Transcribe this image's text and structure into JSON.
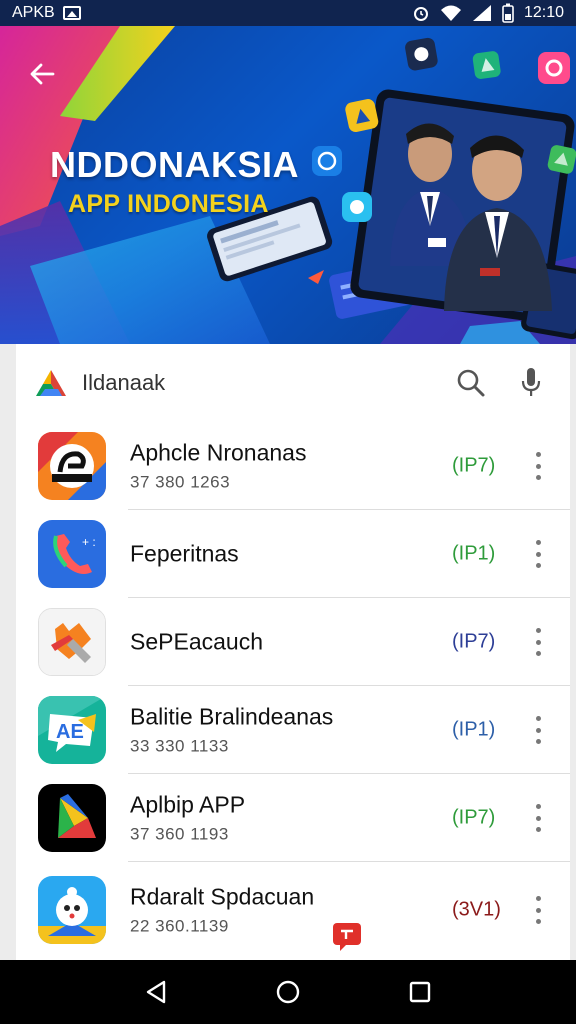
{
  "status_bar": {
    "carrier": "APKB",
    "time": "12:10"
  },
  "hero": {
    "title": "NDDONAKSIA",
    "subtitle": "APP INDONESIA"
  },
  "search": {
    "query": "Ildanaak"
  },
  "apps": [
    {
      "name": "Aphcle Nronanas",
      "number": "37 380 1263",
      "badge": "(IP7)",
      "badge_color": "#2e9b3a"
    },
    {
      "name": "Feperitnas",
      "number": "",
      "badge": "(IP1)",
      "badge_color": "#2e9b3a"
    },
    {
      "name": "SePEacauch",
      "number": "",
      "badge": "(IP7)",
      "badge_color": "#2d3e96"
    },
    {
      "name": "Balitie Bralindeanas",
      "number": "33 330 1133",
      "badge": "(IP1)",
      "badge_color": "#2d5fa8"
    },
    {
      "name": "Aplbip APP",
      "number": "37 360 1193",
      "badge": "(IP7)",
      "badge_color": "#2e9b3a"
    },
    {
      "name": "Rdaralt Spdacuan",
      "number": "22 360.1139",
      "badge": "(3V1)",
      "badge_color": "#8b1a1a"
    }
  ],
  "colors": {
    "status_bar": "#10244f",
    "hero_blue": "#0a58c9",
    "accent_yellow": "#f4d21d"
  },
  "icons": [
    "back-arrow-icon",
    "search-icon",
    "microphone-icon",
    "more-vert-icon",
    "nav-back-icon",
    "nav-home-icon",
    "nav-recents-icon"
  ]
}
